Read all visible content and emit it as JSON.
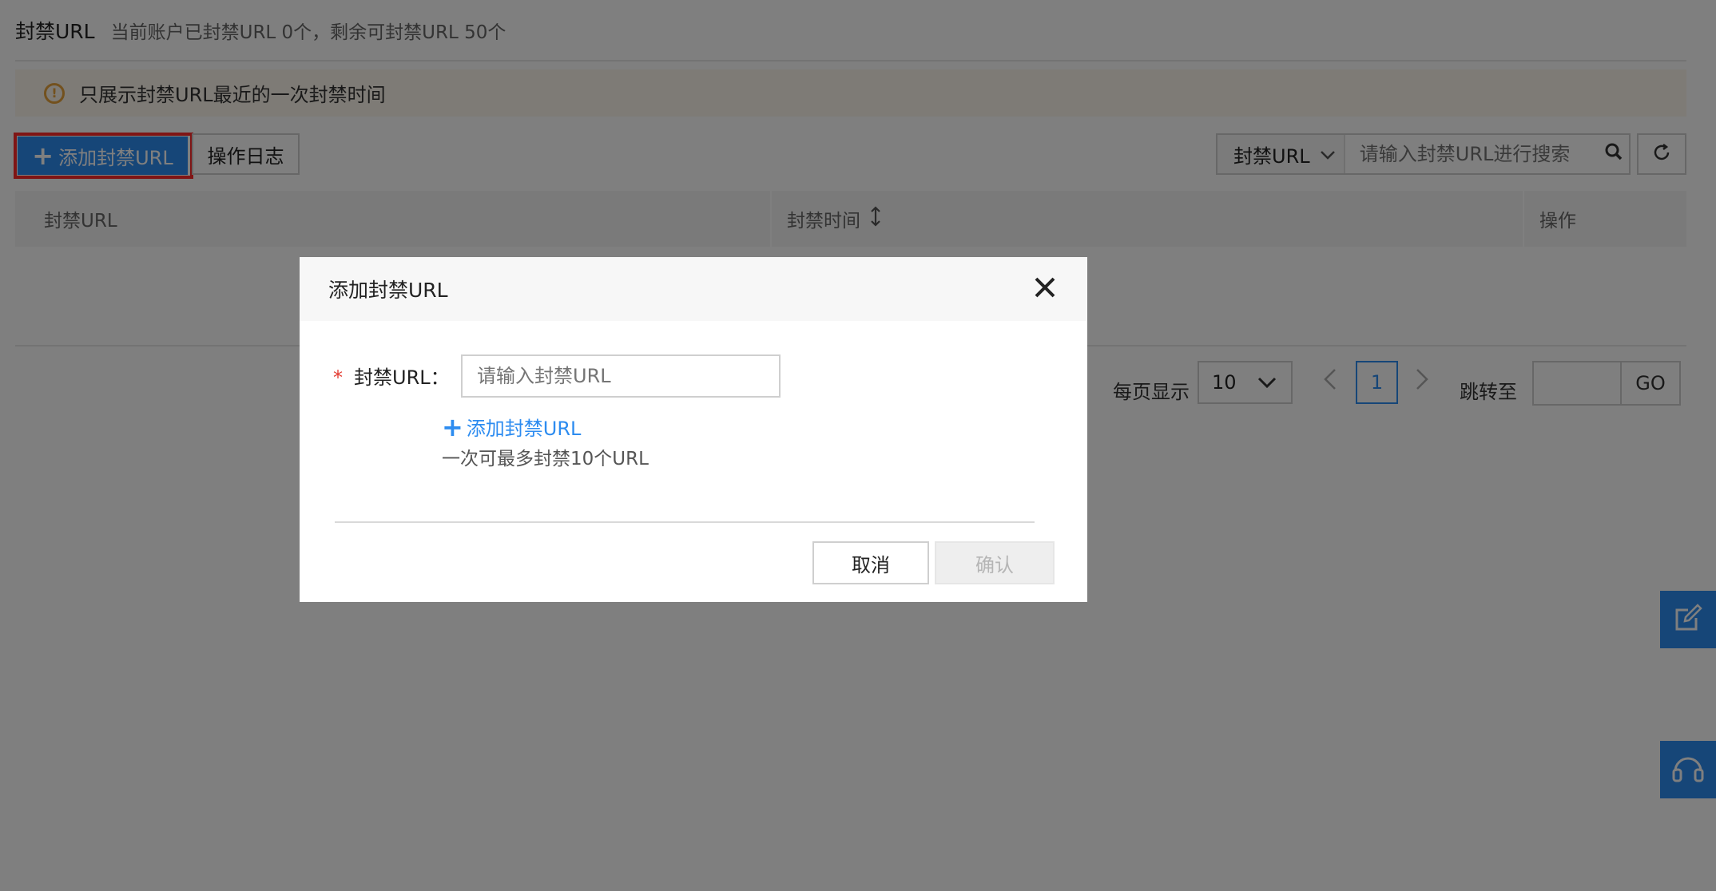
{
  "header": {
    "title": "封禁URL",
    "subtitle": "当前账户已封禁URL 0个，剩余可封禁URL 50个"
  },
  "notice": {
    "icon": "warning-circle-icon",
    "text": "只展示封禁URL最近的一次封禁时间"
  },
  "toolbar": {
    "add_label": "添加封禁URL",
    "log_label": "操作日志",
    "search_field": "封禁URL",
    "search_placeholder": "请输入封禁URL进行搜索"
  },
  "table": {
    "columns": [
      "封禁URL",
      "封禁时间",
      "操作"
    ]
  },
  "pagination": {
    "per_page_label": "每页显示",
    "per_page_value": "10",
    "current_page": "1",
    "jump_label": "跳转至",
    "go_label": "GO"
  },
  "dialog": {
    "title": "添加封禁URL",
    "field_label": "封禁URL：",
    "field_placeholder": "请输入封禁URL",
    "add_link": "添加封禁URL",
    "hint": "一次可最多封禁10个URL",
    "cancel_label": "取消",
    "confirm_label": "确认"
  },
  "colors": {
    "primary": "#2d8cf0",
    "highlight": "#ff2a2a",
    "warning": "#e6a23c"
  }
}
